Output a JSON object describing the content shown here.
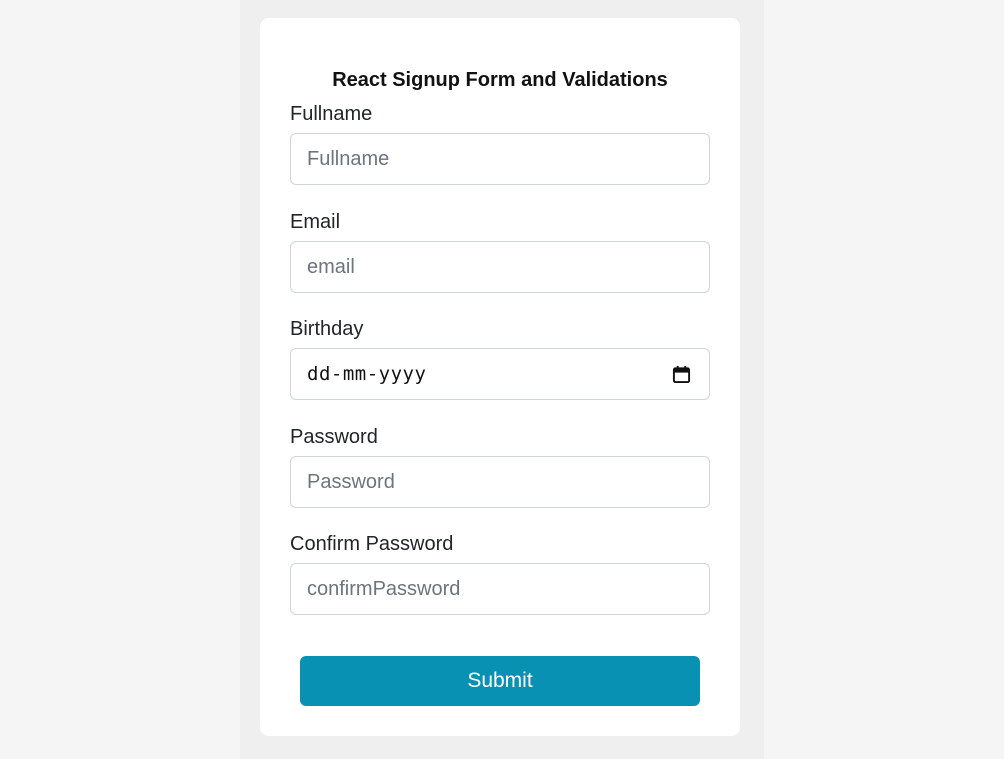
{
  "form": {
    "title": "React Signup Form and Validations",
    "fields": [
      {
        "label": "Fullname",
        "placeholder": "Fullname"
      },
      {
        "label": "Email",
        "placeholder": "email"
      },
      {
        "label": "Birthday",
        "placeholder": "dd-mm-yyyy",
        "icon": "calendar-icon"
      },
      {
        "label": "Password",
        "placeholder": "Password"
      },
      {
        "label": "Confirm Password",
        "placeholder": "confirmPassword"
      }
    ],
    "submit_label": "Submit"
  },
  "colors": {
    "page_background": "#f4f5f4",
    "panel_background": "#efefef",
    "card_background": "#ffffff",
    "accent": "#0891b2"
  }
}
